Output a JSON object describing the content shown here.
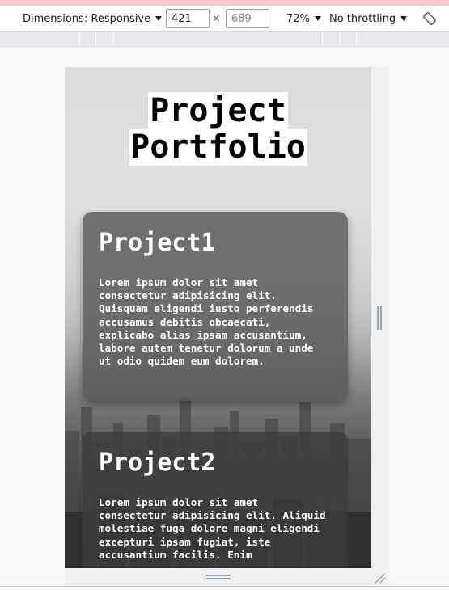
{
  "toolbar": {
    "dimensions_label": "Dimensions: Responsive",
    "width_value": "421",
    "height_placeholder": "689",
    "times_symbol": "×",
    "zoom_label": "72%",
    "throttling_label": "No throttling",
    "rotate_icon": "rotate-icon"
  },
  "page": {
    "title_line1": "Project",
    "title_line2": "Portfolio",
    "projects": [
      {
        "name": "Project1",
        "description": "Lorem ipsum dolor sit amet consectetur adipisicing elit. Quisquam eligendi iusto perferendis accusamus debitis obcaecati, explicabo alias ipsam accusantium, labore autem tenetur dolorum a unde ut odio quidem eum dolorem."
      },
      {
        "name": "Project2",
        "description": "Lorem ipsum dolor sit amet consectetur adipisicing elit. Aliquid molestiae fuga dolore magni eligendi excepturi ipsam fugiat, iste accusantium facilis. Enim"
      }
    ]
  },
  "colors": {
    "pink_strip": "#f8c8d4",
    "title_highlight": "#ffffff",
    "card_bg": "#585858"
  }
}
